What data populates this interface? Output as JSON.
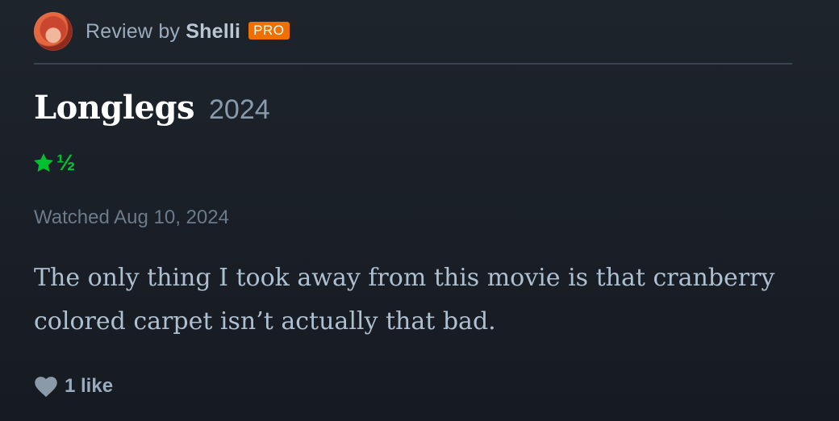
{
  "review": {
    "prefix": "Review by",
    "author": "Shelli",
    "badge": "PRO",
    "badge_color": "#ee7000"
  },
  "film": {
    "title": "Longlegs",
    "year": "2024"
  },
  "rating": {
    "value": 1.5,
    "max": 5,
    "half_symbol": "½",
    "star_icon": "star-icon",
    "color": "#00c030"
  },
  "watched": "Watched Aug 10, 2024",
  "body": "The only thing I took away from this movie is that cranberry colored carpet isn’t actually that bad.",
  "likes": {
    "icon": "heart-icon",
    "label": "1 like"
  }
}
